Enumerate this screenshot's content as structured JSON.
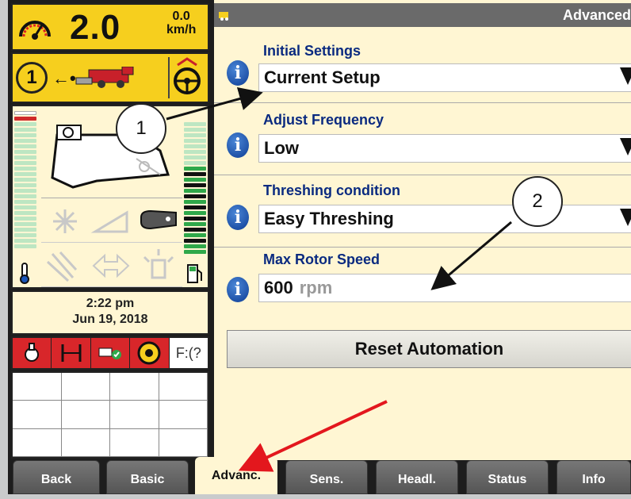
{
  "speed": {
    "value": "2.0",
    "small_value": "0.0",
    "unit": "km/h"
  },
  "gear": {
    "number": "1",
    "arrow": "←•"
  },
  "clock": {
    "time": "2:22 pm",
    "date": "Jun 19, 2018"
  },
  "alarm_strip": {
    "last_cell": "F:(?"
  },
  "panel": {
    "title": "Advanced",
    "settings": [
      {
        "label": "Initial Settings",
        "value": "Current Setup",
        "dropdown": true
      },
      {
        "label": "Adjust Frequency",
        "value": "Low",
        "dropdown": true
      },
      {
        "label": "Threshing condition",
        "value": "Easy Threshing",
        "dropdown": true
      },
      {
        "label": "Max Rotor Speed",
        "value": "600",
        "unit": "rpm",
        "dropdown": false
      }
    ],
    "reset_label": "Reset Automation"
  },
  "tabs": [
    {
      "label": "Back",
      "active": false
    },
    {
      "label": "Basic",
      "active": false
    },
    {
      "label": "Advanc.",
      "active": true
    },
    {
      "label": "Sens.",
      "active": false
    },
    {
      "label": "Headl.",
      "active": false
    },
    {
      "label": "Status",
      "active": false
    },
    {
      "label": "Info",
      "active": false
    }
  ],
  "callouts": [
    "1",
    "2"
  ],
  "colors": {
    "accent_yellow": "#f6cf1e",
    "panel_cream": "#fff6d3",
    "label_blue": "#0a2a80",
    "info_blue": "#1a56b8",
    "alarm_red": "#d8262a",
    "annotation_red": "#e3171d",
    "gauge_green": "#2fa84a"
  },
  "icons": [
    "speedometer-icon",
    "combine-icon",
    "steering-wheel-icon",
    "fan-icon",
    "concave-icon",
    "thermometer-icon",
    "fuel-icon",
    "info-icon",
    "dropdown-arrow-icon"
  ]
}
